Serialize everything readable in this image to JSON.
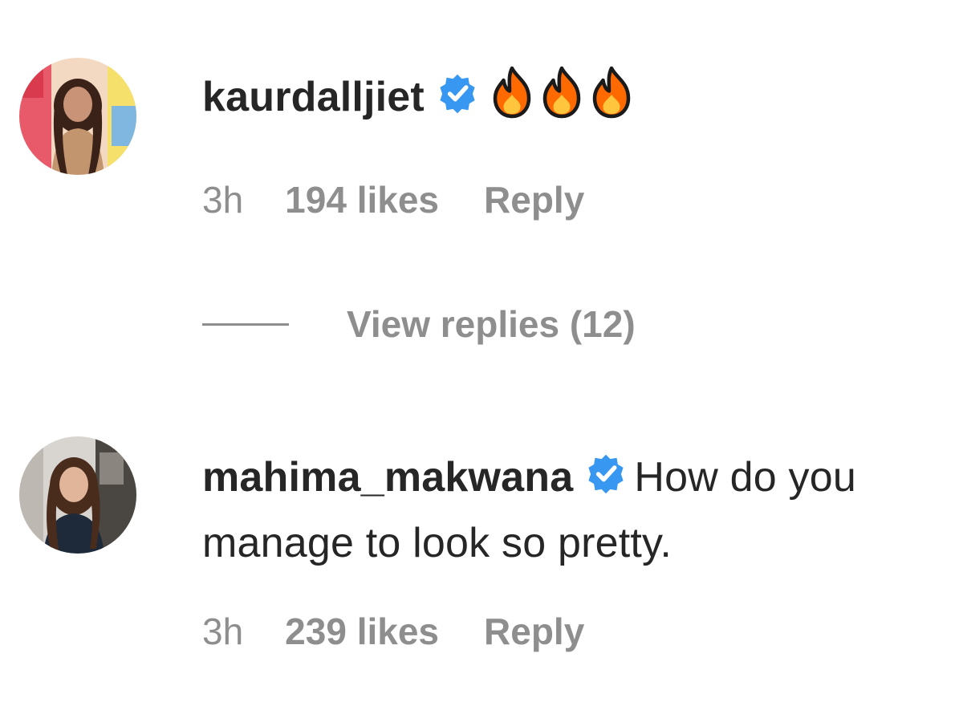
{
  "comments": [
    {
      "username": "kaurdalljiet",
      "verified": true,
      "text": "",
      "emoji_icons": [
        "fire-icon",
        "fire-icon",
        "fire-icon"
      ],
      "time": "3h",
      "likes": "194 likes",
      "reply_label": "Reply",
      "view_replies": "View replies (12)"
    },
    {
      "username": "mahima_makwana",
      "verified": true,
      "text": "How do you manage to look so pretty.",
      "time": "3h",
      "likes": "239 likes",
      "reply_label": "Reply"
    }
  ],
  "colors": {
    "text": "#262626",
    "secondary": "#8e8e8e",
    "verified": "#3897f0",
    "fire": "#ff6a00"
  }
}
